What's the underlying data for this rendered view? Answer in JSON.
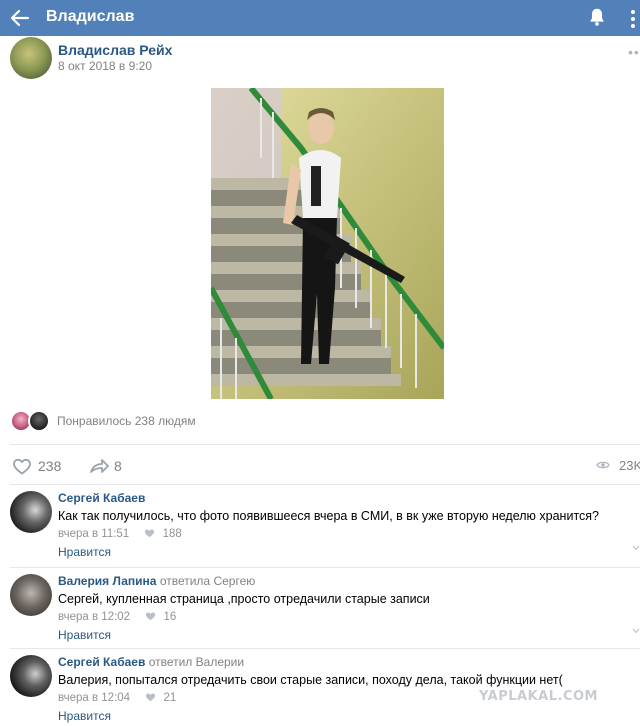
{
  "header": {
    "title": "Владислав",
    "bg_color": "#5181b8",
    "back_icon": "arrow-left-icon",
    "bell_icon": "bell-icon",
    "more_icon": "more-vertical-icon"
  },
  "post": {
    "author": "Владислав Рейх",
    "date": "8 окт 2018 в 9:20",
    "menu_icon": "more-horizontal-icon",
    "likes_text": "Понравилось 238 людям",
    "likes_count": "238",
    "shares_count": "8",
    "views_count": "23K"
  },
  "comments": [
    {
      "author": "Сергей Кабаев",
      "reply_to": "",
      "text": "Как так получилось, что фото появившееся вчера в СМИ, в вк уже вторую неделю хранится?",
      "time": "вчера в 11:51",
      "likes": "188",
      "like_label": "Нравится"
    },
    {
      "author": "Валерия Лапина",
      "reply_to": "ответила Сергею",
      "text": "Сергей, купленная страница ,просто отредачили старые записи",
      "time": "вчера в 12:02",
      "likes": "16",
      "like_label": "Нравится"
    },
    {
      "author": "Сергей Кабаев",
      "reply_to": "ответил Валерии",
      "text": "Валерия, попытался отредачить свои старые записи, походу дела, такой функции нет(",
      "time": "вчера в 12:04",
      "likes": "21",
      "like_label": "Нравится"
    }
  ],
  "watermark": "YAPLAKAL.COM",
  "colors": {
    "link": "#2a5885",
    "muted": "#828282",
    "separator": "#e7e8ec"
  }
}
